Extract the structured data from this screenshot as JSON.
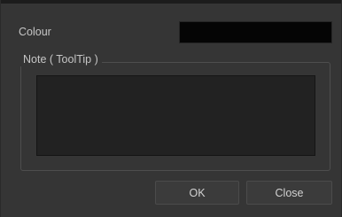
{
  "colour": {
    "label": "Colour",
    "value_hex": "#050505"
  },
  "note": {
    "legend": "Note ( ToolTip )",
    "value": ""
  },
  "buttons": {
    "ok_label": "OK",
    "close_label": "Close"
  }
}
